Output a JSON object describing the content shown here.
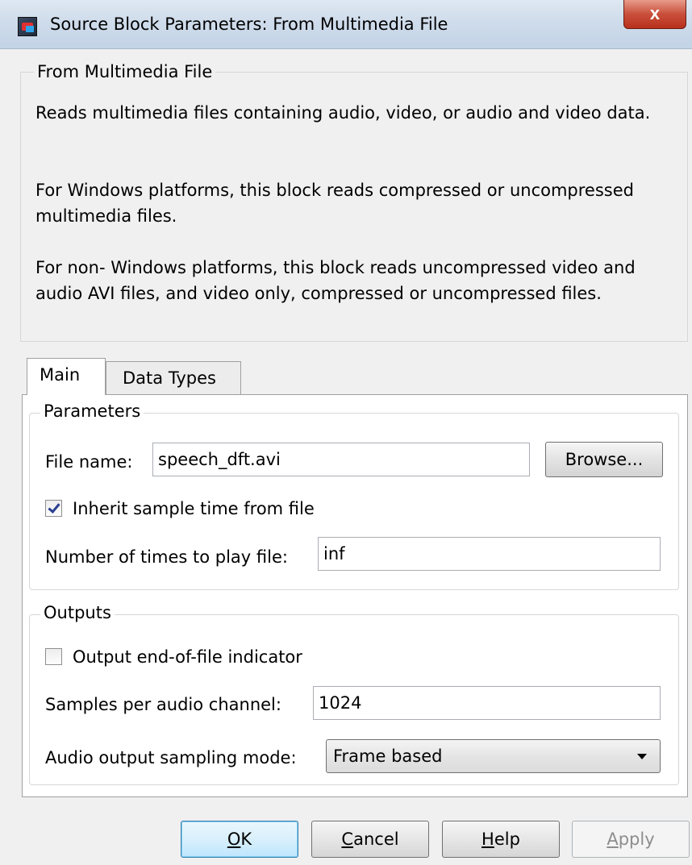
{
  "window": {
    "title": "Source Block Parameters: From Multimedia File",
    "close_label": "x",
    "app_icon": "simulink-block-icon"
  },
  "description": {
    "group_title": "From Multimedia File",
    "paragraphs": [
      "Reads multimedia files containing audio, video, or audio and video data.",
      "For Windows platforms, this block reads compressed or uncompressed multimedia files.",
      "For non- Windows platforms, this block reads uncompressed video and audio AVI files, and video only, compressed or uncompressed files."
    ]
  },
  "tabs": {
    "main": "Main",
    "data_types": "Data Types",
    "selected": "Main"
  },
  "parameters": {
    "group_title": "Parameters",
    "file_name_label": "File name:",
    "file_name_value": "speech_dft.avi",
    "browse_label": "Browse...",
    "inherit_label": "Inherit sample time from file",
    "inherit_checked": true,
    "times_label": "Number of times to play file:",
    "times_value": "inf"
  },
  "outputs": {
    "group_title": "Outputs",
    "eof_label": "Output end-of-file indicator",
    "eof_checked": false,
    "samples_label": "Samples per audio channel:",
    "samples_value": "1024",
    "mode_label": "Audio output sampling mode:",
    "mode_value": "Frame based"
  },
  "buttons": {
    "ok": {
      "mnemonic": "O",
      "rest": "K"
    },
    "cancel": {
      "mnemonic": "C",
      "rest": "ancel"
    },
    "help": {
      "mnemonic": "H",
      "rest": "elp"
    },
    "apply": {
      "mnemonic": "A",
      "rest": "pply",
      "enabled": false
    }
  }
}
